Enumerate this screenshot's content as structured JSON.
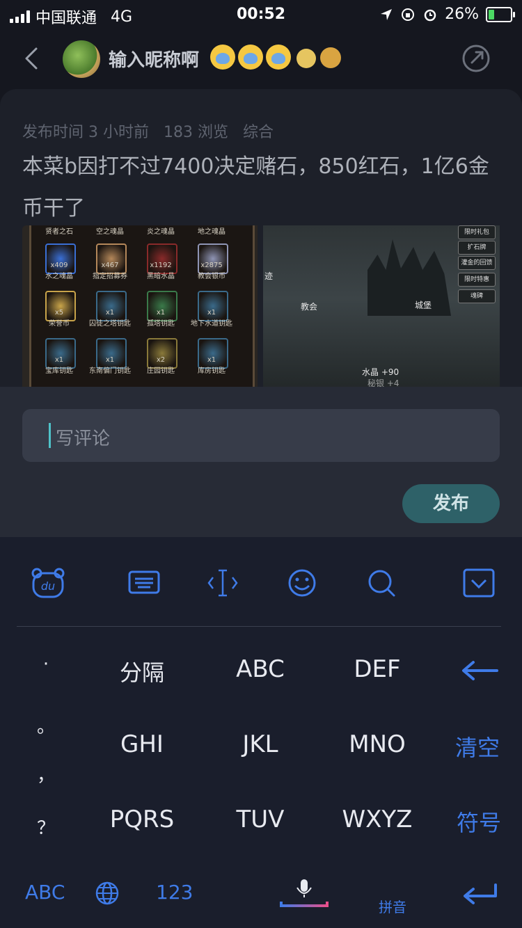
{
  "status": {
    "carrier": "中国联通",
    "network": "4G",
    "time": "00:52",
    "battery": "26%"
  },
  "header": {
    "username": "输入昵称啊"
  },
  "post": {
    "meta": {
      "time": "发布时间 3 小时前",
      "views": "183 浏览",
      "category": "综合"
    },
    "title": "本菜b因打不过7400决定赌石，850红石，1亿6金币干了",
    "inventory": [
      {
        "count": "x409",
        "name": "水之魂晶",
        "color": "#3a6fd6"
      },
      {
        "count": "x467",
        "name": "指定招募券",
        "color": "#b5885a"
      },
      {
        "count": "x1192",
        "name": "黑暗水晶",
        "color": "#8a2a2a"
      },
      {
        "count": "x2875",
        "name": "教会银币",
        "color": "#8f95b5"
      },
      {
        "count": "x5",
        "name": "荣誉币",
        "color": "#c9a44a"
      },
      {
        "count": "x1",
        "name": "囚徒之塔钥匙",
        "color": "#3a6a8a"
      },
      {
        "count": "x1",
        "name": "孤塔钥匙",
        "color": "#3a7a4a"
      },
      {
        "count": "x1",
        "name": "地下水道钥匙",
        "color": "#3a6a8a"
      },
      {
        "count": "x1",
        "name": "宝库钥匙",
        "color": "#3a6a8a"
      },
      {
        "count": "x1",
        "name": "东南偏门钥匙",
        "color": "#3a6a8a"
      },
      {
        "count": "x2",
        "name": "庄园钥匙",
        "color": "#8a7a3a"
      },
      {
        "count": "x1",
        "name": "库房钥匙",
        "color": "#3a6a8a"
      }
    ],
    "inventory_top_labels": [
      "贤者之石",
      "空之魂晶",
      "炎之魂晶",
      "地之魂晶"
    ],
    "game_menu": [
      "限时礼包",
      "扩石牌",
      "灌金的回馈",
      "限时特惠",
      "魂碑"
    ],
    "game_labels": {
      "trace": "迹",
      "church": "教会",
      "castle": "城堡",
      "crystal": "水晶 +90",
      "extra": "秘银 +4"
    }
  },
  "comment": {
    "placeholder": "写评论",
    "publish": "发布"
  },
  "keyboard": {
    "punct": [
      "·",
      "。",
      "，",
      "？"
    ],
    "row1": [
      "分隔",
      "ABC",
      "DEF"
    ],
    "row2": [
      "GHI",
      "JKL",
      "MNO"
    ],
    "row3": [
      "PQRS",
      "TUV",
      "WXYZ"
    ],
    "clear": "清空",
    "symbol": "符号",
    "bottom": {
      "abc": "ABC",
      "num": "123",
      "pinyin": "拼音"
    },
    "toolbar_logo": "du"
  }
}
